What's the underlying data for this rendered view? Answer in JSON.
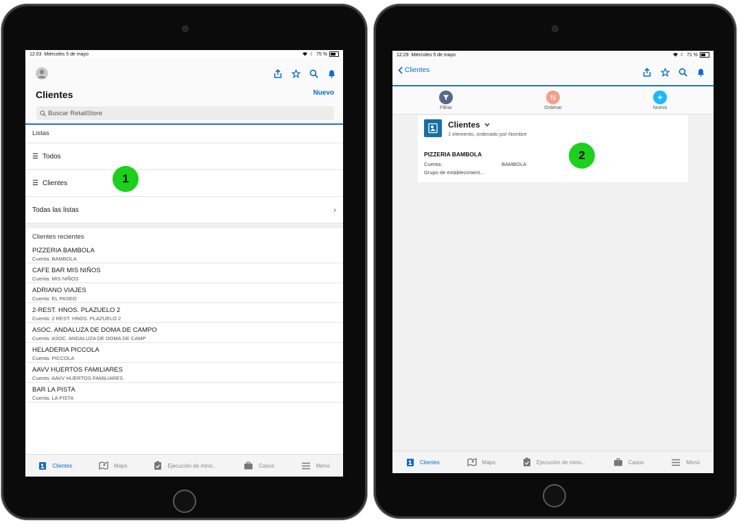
{
  "left": {
    "status": {
      "time": "12:03",
      "date": "Miércoles 5 de mayo",
      "battery": "75 %",
      "battery_level": 0.75
    },
    "header": {
      "title": "Clientes",
      "new_label": "Nuevo",
      "search_placeholder": "Buscar RetailStore"
    },
    "lists": {
      "section_title": "Listas",
      "items": [
        {
          "label": "Todos"
        },
        {
          "label": "Clientes"
        }
      ],
      "all_lists_label": "Todas las listas"
    },
    "recent": {
      "section_title": "Clientes recientes",
      "items": [
        {
          "title": "PIZZERIA BAMBOLA",
          "sub": "Cuenta: BAMBOLA"
        },
        {
          "title": "CAFE BAR MIS NIÑOS",
          "sub": "Cuenta: MIS NIÑOS"
        },
        {
          "title": "ADRIANO VIAJES",
          "sub": "Cuenta: EL PASEO"
        },
        {
          "title": "2-REST. HNOS. PLAZUELO 2",
          "sub": "Cuenta: 2 REST. HNOS. PLAZUELO 2"
        },
        {
          "title": "ASOC. ANDALUZA DE DOMA DE CAMPO",
          "sub": "Cuenta: ASOC. ANDALUZA DE DOMA DE CAMP"
        },
        {
          "title": "HELADERIA PICCOLA",
          "sub": "Cuenta: PICCOLA"
        },
        {
          "title": "AAVV HUERTOS  FAMILIARES",
          "sub": "Cuenta: AAVV HUERTOS FAMILIARES"
        },
        {
          "title": "BAR LA PISTA",
          "sub": "Cuenta: LA PISTA"
        }
      ]
    },
    "badge": "1"
  },
  "right": {
    "status": {
      "time": "12:29",
      "date": "Miércoles 5 de mayo",
      "battery": "71 %",
      "battery_level": 0.71
    },
    "header": {
      "back_label": "Clientes"
    },
    "actions": {
      "filter": "Filtrar",
      "sort": "Ordenar",
      "new": "Nuevo"
    },
    "listview": {
      "title": "Clientes",
      "subtitle": "1 elemento, ordenado por Nombre",
      "record": {
        "title": "PIZZERIA BAMBOLA",
        "field1_label": "Cuenta:",
        "field1_value": "BAMBOLA",
        "field2_label": "Grupo de establecimient..."
      }
    },
    "badge": "2"
  },
  "tabbar": {
    "items": [
      {
        "label": "Clientes",
        "icon": "clientes-icon"
      },
      {
        "label": "Maps",
        "icon": "map-icon"
      },
      {
        "label": "Ejecución de mino...",
        "icon": "clipboard-icon"
      },
      {
        "label": "Casos",
        "icon": "briefcase-icon"
      },
      {
        "label": "Menú",
        "icon": "menu-icon"
      }
    ]
  },
  "colors": {
    "accent": "#0b6bcb",
    "badge": "#1bd11b",
    "filter": "#54698d",
    "sort": "#f4a08a",
    "new": "#1ab9ff"
  }
}
